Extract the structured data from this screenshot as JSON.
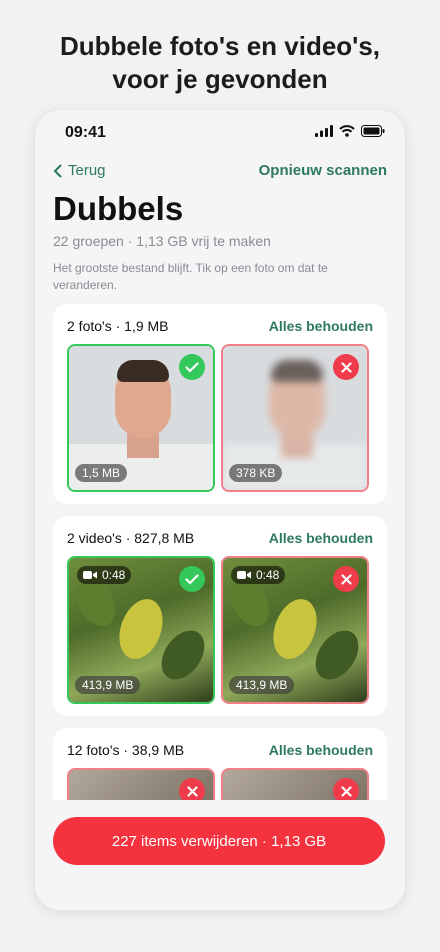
{
  "headline": {
    "line1": "Dubbele foto's en video's,",
    "line2": "voor je gevonden"
  },
  "statusbar": {
    "time": "09:41"
  },
  "nav": {
    "back_label": "Terug",
    "rescan_label": "Opnieuw scannen"
  },
  "page": {
    "title": "Dubbels",
    "subtitle": "22 groepen · 1,13 GB vrij te maken",
    "hint": "Het grootste bestand blijft. Tik op een foto om dat te veranderen."
  },
  "groups": [
    {
      "count_label": "2 foto's · 1,9 MB",
      "keep_label": "Alles behouden",
      "items": [
        {
          "size": "1,5 MB",
          "state": "keep"
        },
        {
          "size": "378 KB",
          "state": "delete"
        }
      ]
    },
    {
      "count_label": "2 video's · 827,8 MB",
      "keep_label": "Alles behouden",
      "items": [
        {
          "size": "413,9 MB",
          "duration": "0:48",
          "state": "keep"
        },
        {
          "size": "413,9 MB",
          "duration": "0:48",
          "state": "delete"
        }
      ]
    },
    {
      "count_label": "12 foto's · 38,9 MB",
      "keep_label": "Alles behouden",
      "items": [
        {
          "state": "delete"
        },
        {
          "state": "delete"
        }
      ]
    }
  ],
  "action": {
    "delete_label": "227 items verwijderen · 1,13 GB"
  },
  "colors": {
    "accent": "#2d7a5e",
    "keep": "#34c759",
    "delete": "#ef3c4a"
  }
}
